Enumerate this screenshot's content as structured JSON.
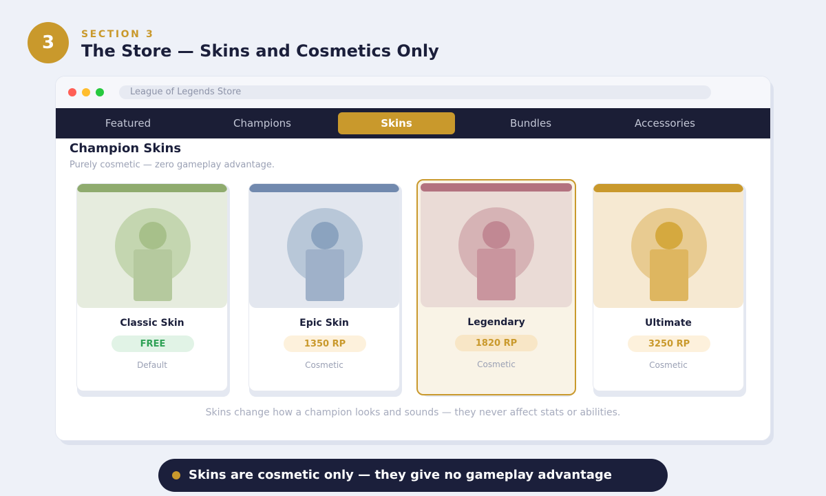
{
  "section": {
    "number": "3",
    "kicker": "SECTION 3",
    "title": "The Store — Skins and Cosmetics Only"
  },
  "window": {
    "address": "League of Legends Store"
  },
  "nav": {
    "tabs": [
      {
        "label": "Featured",
        "active": false
      },
      {
        "label": "Champions",
        "active": false
      },
      {
        "label": "Skins",
        "active": true
      },
      {
        "label": "Bundles",
        "active": false
      },
      {
        "label": "Accessories",
        "active": false
      }
    ]
  },
  "content": {
    "title": "Champion Skins",
    "subtitle": "Purely cosmetic — zero gameplay advantage.",
    "footnote": "Skins change how a champion looks and sounds — they never affect stats or abilities."
  },
  "cards": [
    {
      "name": "Classic Skin",
      "price": "FREE",
      "type": "Default",
      "featured": false,
      "colors": {
        "bar": "#8fab6e",
        "art": "#e6ecde",
        "ring": "#c4d6b0",
        "figure": "#a7c08a",
        "figure_body": "#b5c99e",
        "pill_bg": "#e1f3e6",
        "pill_text": "#2ea155"
      }
    },
    {
      "name": "Epic Skin",
      "price": "1350 RP",
      "type": "Cosmetic",
      "featured": false,
      "colors": {
        "bar": "#7189ae",
        "art": "#e3e7ef",
        "ring": "#b8c7d8",
        "figure": "#8ba3bf",
        "figure_body": "#9fb1c9",
        "pill_bg": "#fdf1dc",
        "pill_text": "#c9992c"
      }
    },
    {
      "name": "Legendary",
      "price": "1820 RP",
      "type": "Cosmetic",
      "featured": true,
      "colors": {
        "bar": "#b3727f",
        "art": "#eadbd6",
        "ring": "#d6b3b5",
        "figure": "#c18893",
        "figure_body": "#c9959e",
        "pill_bg": "#f8e6c6",
        "pill_text": "#c9992c"
      }
    },
    {
      "name": "Ultimate",
      "price": "3250 RP",
      "type": "Cosmetic",
      "featured": false,
      "colors": {
        "bar": "#c9992c",
        "art": "#f6e9d2",
        "ring": "#e8cb91",
        "figure": "#d5a93f",
        "figure_body": "#deb660",
        "pill_bg": "#fdf1dc",
        "pill_text": "#c9992c"
      }
    }
  ],
  "banner": {
    "text": "Skins are cosmetic only — they give no gameplay advantage"
  }
}
